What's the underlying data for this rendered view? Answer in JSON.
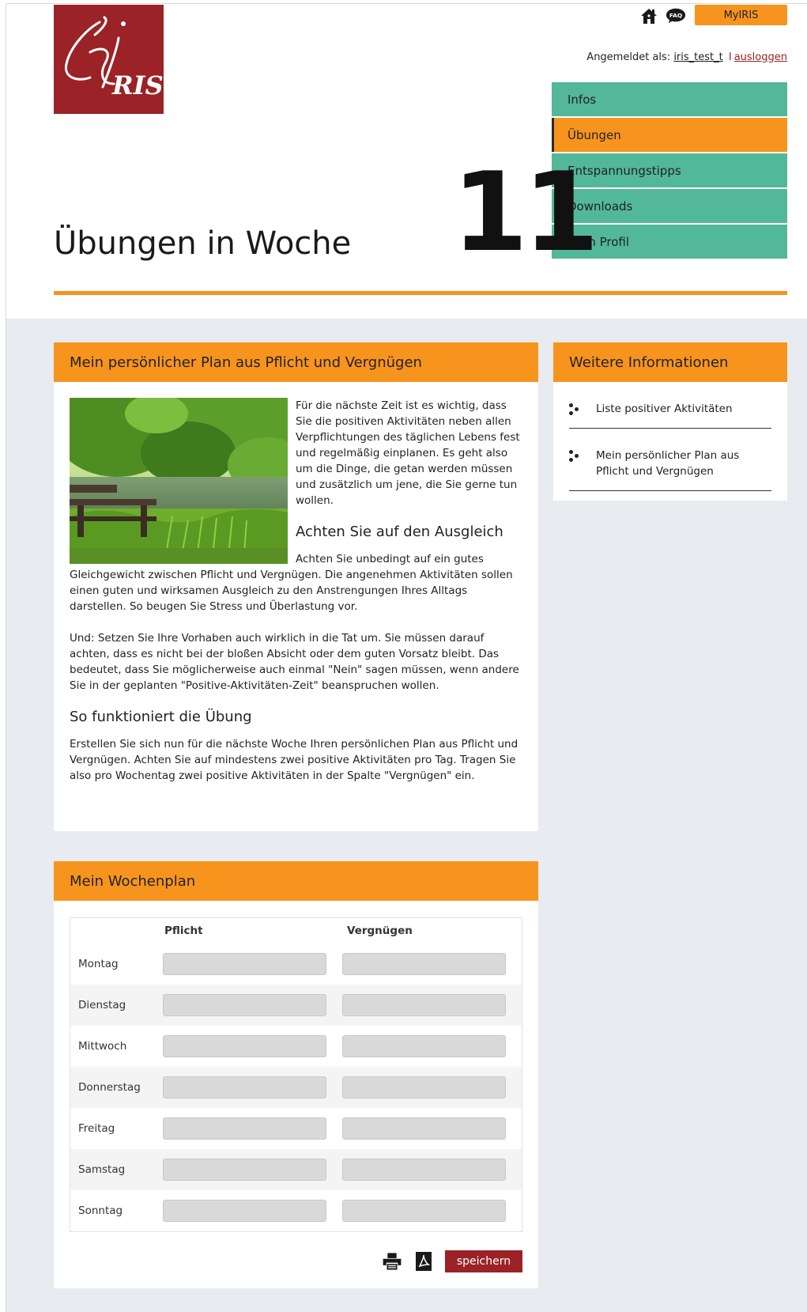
{
  "header": {
    "logo_text": "ISIRIS",
    "icons": [
      "home-icon",
      "faq-icon"
    ],
    "faq_label": "FAQ",
    "myiris_label": "MyIRIS",
    "login_prefix": "Angemeldet als:",
    "username": "iris_test_t",
    "separator": "I",
    "logout_label": "ausloggen"
  },
  "nav": {
    "items": [
      {
        "label": "Infos",
        "active": false
      },
      {
        "label": "Übungen",
        "active": true
      },
      {
        "label": "Entspannungstipps",
        "active": false
      },
      {
        "label": "Downloads",
        "active": false
      },
      {
        "label": "Mein Profil",
        "active": false
      }
    ]
  },
  "page": {
    "title": "Übungen in Woche",
    "week": "11"
  },
  "main_panel": {
    "heading": "Mein persönlicher Plan aus Pflicht und Vergnügen",
    "image_desc": "bench-by-lake",
    "intro": "Für die nächste Zeit ist es wichtig, dass Sie die positiven Aktivitäten neben allen Verpflichtungen des täglichen Lebens fest und regelmäßig einplanen. Es geht also um die Dinge, die getan werden müssen und zusätzlich um jene, die Sie gerne tun wollen.",
    "subheading1": "Achten Sie auf den Ausgleich",
    "para1": "Achten Sie unbedingt auf ein gutes Gleichgewicht zwischen Pflicht und Vergnügen. Die angenehmen Aktivitäten sollen einen guten und wirksamen Ausgleich zu den Anstrengungen Ihres Alltags darstellen. So beugen Sie Stress und Überlastung vor.",
    "para2": "Und: Setzen Sie Ihre Vorhaben auch wirklich in die Tat um. Sie müssen darauf achten, dass es nicht bei der bloßen Absicht oder dem guten Vorsatz bleibt. Das bedeutet, dass Sie möglicherweise auch einmal \"Nein\" sagen müssen, wenn andere Sie in der geplanten \"Positive-Aktivitäten-Zeit\" beanspruchen wollen.",
    "subheading2": "So funktioniert die Übung",
    "para3": "Erstellen Sie sich nun für die nächste Woche Ihren persönlichen Plan aus Pflicht und Vergnügen. Achten Sie auf mindestens zwei positive Aktivitäten pro Tag. Tragen Sie also pro Wochentag zwei positive Aktivitäten in der Spalte \"Vergnügen\" ein."
  },
  "side_panel": {
    "heading": "Weitere Informationen",
    "items": [
      "Liste positiver Aktivitäten",
      "Mein persönlicher Plan aus Pflicht und Vergnügen"
    ]
  },
  "plan": {
    "heading": "Mein Wochenplan",
    "col_pflicht": "Pflicht",
    "col_vergnuegen": "Vergnügen",
    "days": [
      "Montag",
      "Dienstag",
      "Mittwoch",
      "Donnerstag",
      "Freitag",
      "Samstag",
      "Sonntag"
    ],
    "icons": [
      "print-icon",
      "pdf-icon"
    ],
    "save_label": "speichern"
  },
  "colors": {
    "orange": "#f7941d",
    "green": "#52b899",
    "brand_red": "#9b2226",
    "gray_bg": "#e8ebf0"
  }
}
